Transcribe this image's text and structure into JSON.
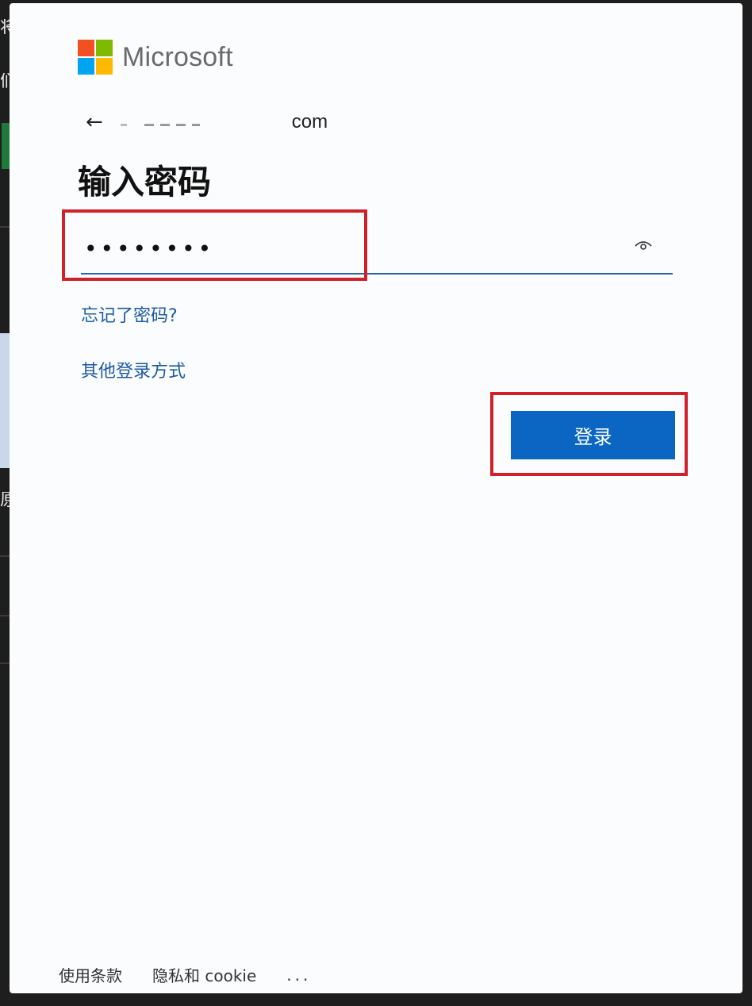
{
  "brand": {
    "name": "Microsoft",
    "logo_colors": [
      "#f25022",
      "#7fba00",
      "#00a4ef",
      "#ffb900"
    ]
  },
  "background_window": {
    "glyphs": [
      "将",
      "们",
      "原"
    ]
  },
  "identity": {
    "back_icon": "←",
    "email_visible_suffix": "com"
  },
  "page": {
    "title": "输入密码"
  },
  "password": {
    "value": "••••••••",
    "reveal_icon": "eye-icon"
  },
  "links": {
    "forgot_password": "忘记了密码?",
    "other_signin": "其他登录方式"
  },
  "actions": {
    "signin_label": "登录"
  },
  "footer": {
    "terms": "使用条款",
    "privacy": "隐私和 cookie",
    "more": "..."
  },
  "colors": {
    "accent": "#0b66c3",
    "link": "#1b5aa6",
    "annotation": "#d0202a"
  }
}
